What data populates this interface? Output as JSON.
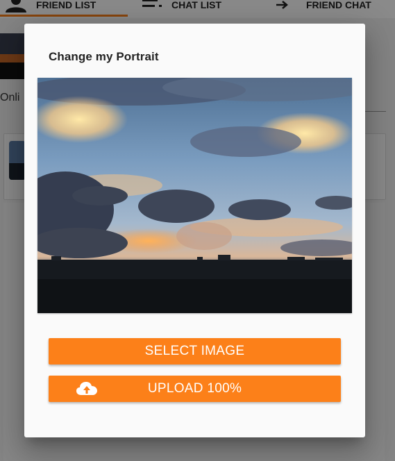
{
  "colors": {
    "accent": "#fc8019",
    "overlay": "rgba(0,0,0,0.46)",
    "dialog_bg": "#fafafa"
  },
  "tabs": [
    {
      "label": "FRIEND LIST",
      "icon": "person-icon",
      "active": true
    },
    {
      "label": "CHAT LIST",
      "icon": "list-icon",
      "active": false
    },
    {
      "label": "FRIEND CHAT",
      "icon": "arrow-right-icon",
      "active": false
    }
  ],
  "background": {
    "status_text": "Onli"
  },
  "dialog": {
    "title": "Change my Portrait",
    "image_description": "sunset sky over city skyline",
    "select_button": "SELECT IMAGE",
    "upload_button": "UPLOAD 100%",
    "upload_icon": "cloud-upload-icon",
    "upload_progress": 100
  }
}
